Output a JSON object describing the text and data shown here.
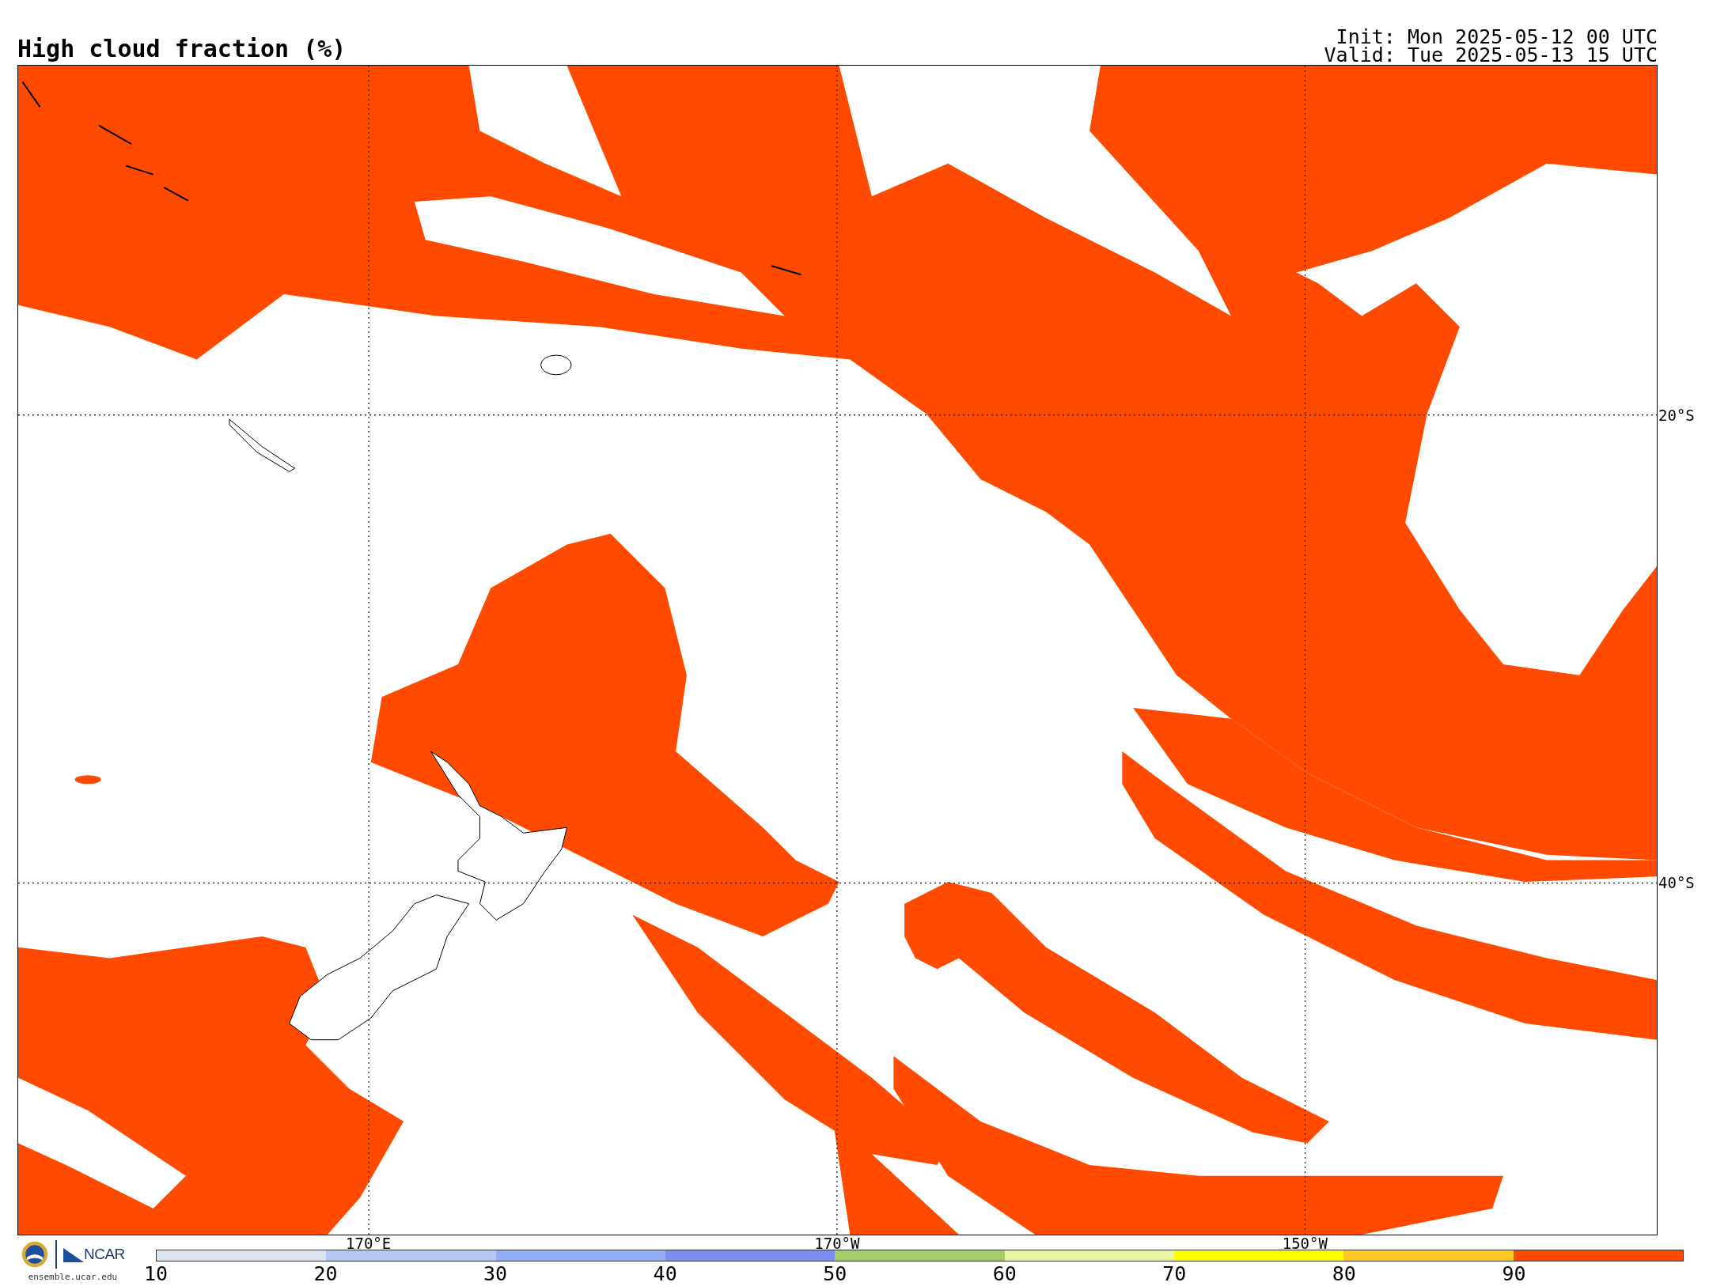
{
  "title": "High cloud fraction (%)",
  "init": "Init: Mon 2025-05-12 00 UTC",
  "valid": "Valid: Tue 2025-05-13 15 UTC",
  "map": {
    "lon_labels": [
      "170°E",
      "170°W",
      "150°W"
    ],
    "lat_labels": [
      "20°S",
      "40°S"
    ]
  },
  "logo": {
    "name": "NCAR",
    "url": "ensemble.ucar.edu"
  },
  "colorbar": {
    "segments": [
      {
        "label": "10",
        "color": "#dce5ee"
      },
      {
        "label": "20",
        "color": "#b4c8f6"
      },
      {
        "label": "30",
        "color": "#8fb0f7"
      },
      {
        "label": "40",
        "color": "#7c90f4"
      },
      {
        "label": "50",
        "color": "#a5cc66"
      },
      {
        "label": "60",
        "color": "#e8f4a2"
      },
      {
        "label": "70",
        "color": "#ffff00"
      },
      {
        "label": "80",
        "color": "#ffc822"
      },
      {
        "label": "90",
        "color": "#ff4a00"
      }
    ]
  }
}
